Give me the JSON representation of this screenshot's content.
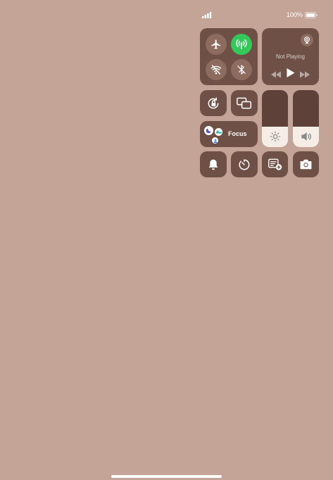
{
  "status_bar": {
    "battery_percent": "100%",
    "battery_level": 1.0,
    "signal_bars": 4,
    "battery_icon": "battery-full-icon"
  },
  "connectivity": [
    {
      "name": "airplane-mode",
      "icon": "airplane-icon",
      "active": false
    },
    {
      "name": "cellular-data",
      "icon": "antenna-icon",
      "active": true,
      "color": "#34c759"
    },
    {
      "name": "wifi",
      "icon": "wifi-off-icon",
      "active": false
    },
    {
      "name": "bluetooth",
      "icon": "bluetooth-off-icon",
      "active": false
    }
  ],
  "now_playing": {
    "status": "Not Playing",
    "icons": [
      "airplay-icon",
      "rewind-icon",
      "play-icon",
      "fast-forward-icon"
    ]
  },
  "focus": {
    "label": "Focus",
    "icons": [
      "moon-icon",
      "bed-icon",
      "person-icon"
    ]
  },
  "controls": [
    {
      "name": "orientation-lock",
      "icon": "rotation-lock-icon"
    },
    {
      "name": "screen-mirroring",
      "icon": "screen-mirroring-icon"
    },
    {
      "name": "silent-mode",
      "icon": "bell-icon"
    },
    {
      "name": "timer",
      "icon": "timer-icon"
    },
    {
      "name": "quick-note",
      "icon": "note-add-icon"
    },
    {
      "name": "camera",
      "icon": "camera-icon"
    }
  ],
  "sliders": [
    {
      "name": "brightness",
      "icon": "sun-icon",
      "level": 0.36
    },
    {
      "name": "volume",
      "icon": "speaker-icon",
      "level": 0.36
    }
  ],
  "colors": {
    "background": "#c4a496",
    "tile": "#6e5046",
    "accent_green": "#34c759",
    "slider_fill": "#f6ede6"
  }
}
